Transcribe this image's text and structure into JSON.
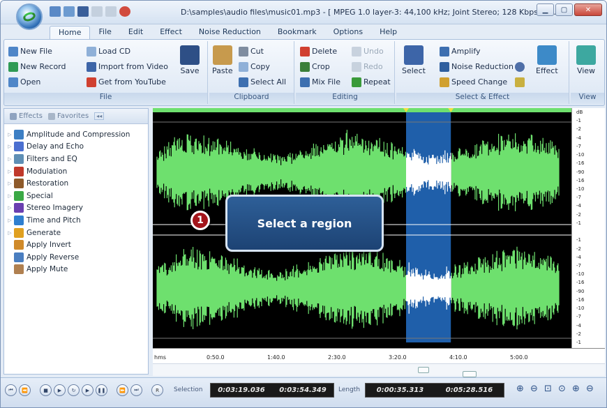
{
  "title": "D:\\samples\\audio files\\music01.mp3 - [ MPEG 1.0 layer-3: 44,100 kHz; Joint Stereo; 128 Kbps; ] - ...",
  "tabs": [
    "Home",
    "File",
    "Edit",
    "Effect",
    "Noise Reduction",
    "Bookmark",
    "Options",
    "Help"
  ],
  "active_tab": "Home",
  "ribbon": {
    "file": {
      "label": "File",
      "new_file": "New File",
      "new_record": "New Record",
      "open": "Open",
      "load_cd": "Load CD",
      "import_video": "Import from Video",
      "get_youtube": "Get from YouTube",
      "save": "Save"
    },
    "clipboard": {
      "label": "Clipboard",
      "paste": "Paste",
      "cut": "Cut",
      "copy": "Copy",
      "select_all": "Select All"
    },
    "editing": {
      "label": "Editing",
      "delete": "Delete",
      "crop": "Crop",
      "mix_file": "Mix File",
      "undo": "Undo",
      "redo": "Redo",
      "repeat": "Repeat"
    },
    "select_effect": {
      "label": "Select & Effect",
      "select": "Select",
      "amplify": "Amplify",
      "noise_reduction": "Noise Reduction",
      "speed_change": "Speed Change",
      "effect": "Effect"
    },
    "view": {
      "label": "View",
      "view": "View"
    }
  },
  "sidebar": {
    "tab_effects": "Effects",
    "tab_favorites": "Favorites",
    "items": [
      {
        "label": "Amplitude and Compression",
        "color": "#3d7fc4"
      },
      {
        "label": "Delay and Echo",
        "color": "#4b6fd0"
      },
      {
        "label": "Filters and EQ",
        "color": "#5f8fb5"
      },
      {
        "label": "Modulation",
        "color": "#c0392b"
      },
      {
        "label": "Restoration",
        "color": "#8e5a2b"
      },
      {
        "label": "Special",
        "color": "#3aa845"
      },
      {
        "label": "Stereo Imagery",
        "color": "#6a3fb0"
      },
      {
        "label": "Time and Pitch",
        "color": "#2f7fcf"
      },
      {
        "label": "Generate",
        "color": "#e0a020"
      },
      {
        "label": "Apply Invert",
        "color": "#d08a2a"
      },
      {
        "label": "Apply Reverse",
        "color": "#4a7ec0"
      },
      {
        "label": "Apply Mute",
        "color": "#b08050"
      }
    ]
  },
  "db_labels": [
    "dB",
    "-1",
    "-2",
    "-4",
    "-7",
    "-10",
    "-16",
    "-90",
    "-16",
    "-10",
    "-7",
    "-4",
    "-2",
    "-1",
    "",
    "-1",
    "-2",
    "-4",
    "-7",
    "-10",
    "-16",
    "-90",
    "-16",
    "-10",
    "-7",
    "-4",
    "-2",
    "-1"
  ],
  "timeline": [
    "hms",
    "0:50.0",
    "1:40.0",
    "2:30.0",
    "3:20.0",
    "4:10.0",
    "5:00.0"
  ],
  "callout": {
    "number": "1",
    "text": "Select a region"
  },
  "status": {
    "selection_label": "Selection",
    "selection_start": "0:03:19.036",
    "selection_end": "0:03:54.349",
    "length_label": "Length",
    "length_sel": "0:00:35.313",
    "length_total": "0:05:28.516"
  },
  "colors": {
    "waveform": "#6ee06e",
    "selection": "#1f5faa",
    "selected_wave": "#ffffff"
  },
  "selection_range": {
    "start_fraction": 0.605,
    "end_fraction": 0.712
  }
}
